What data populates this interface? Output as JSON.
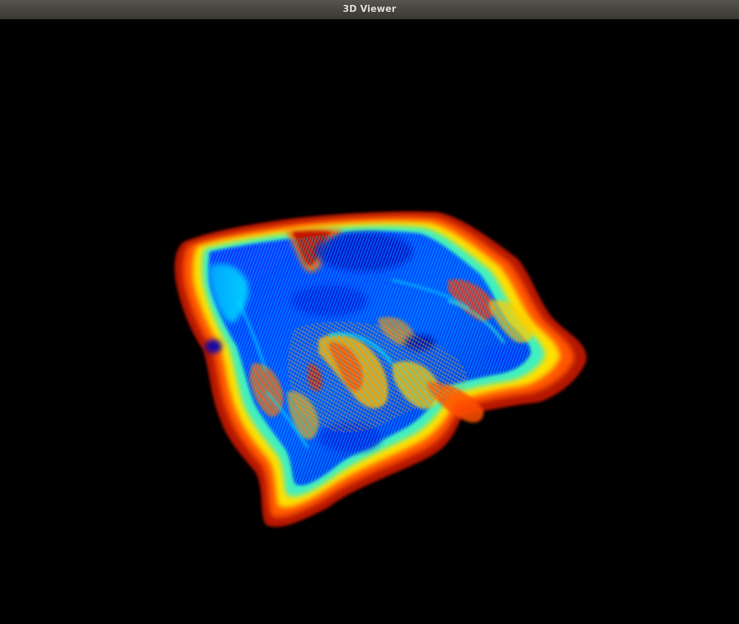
{
  "window": {
    "title": "3D Viewer"
  },
  "viewport": {
    "background": "#000000",
    "colormap": [
      "#00008f",
      "#0000ff",
      "#0080ff",
      "#00ffff",
      "#80ff80",
      "#ffff00",
      "#ff8000",
      "#ff0000",
      "#800000"
    ],
    "content": "point-cloud-mesh"
  }
}
